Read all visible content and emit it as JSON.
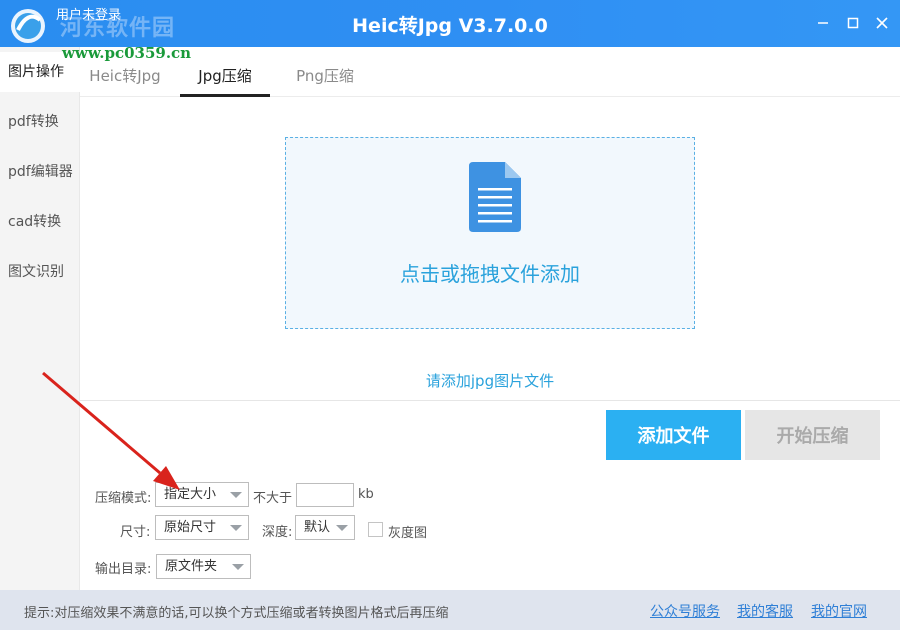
{
  "titlebar": {
    "user_label": "用户未登录",
    "watermark": "河东软件园",
    "watermark_url": "www.pc0359.cn",
    "app_title": "Heic转Jpg V3.7.0.0",
    "controls": [
      "minimize-icon",
      "maximize-icon",
      "close-icon"
    ]
  },
  "sidebar": {
    "items": [
      {
        "label": "图片操作",
        "active": true
      },
      {
        "label": "pdf转换",
        "active": false
      },
      {
        "label": "pdf编辑器",
        "active": false
      },
      {
        "label": "cad转换",
        "active": false
      },
      {
        "label": "图文识别",
        "active": false
      }
    ]
  },
  "tabs": [
    {
      "label": "Heic转Jpg",
      "active": false
    },
    {
      "label": "Jpg压缩",
      "active": true
    },
    {
      "label": "Png压缩",
      "active": false
    }
  ],
  "dropzone": {
    "icon": "document-icon",
    "text": "点击或拖拽文件添加"
  },
  "hint": "请添加jpg图片文件",
  "buttons": {
    "add": "添加文件",
    "start": "开始压缩"
  },
  "settings": {
    "mode_label": "压缩模式:",
    "mode_value": "指定大小",
    "max_label": "不大于",
    "max_value": "",
    "max_unit": "kb",
    "size_label": "尺寸:",
    "size_value": "原始尺寸",
    "depth_label": "深度:",
    "depth_value": "默认",
    "gray_label": "灰度图",
    "gray_checked": false,
    "output_label": "输出目录:",
    "output_value": "原文件夹"
  },
  "footer": {
    "tip": "提示:对压缩效果不满意的话,可以换个方式压缩或者转换图片格式后再压缩",
    "links": [
      "公众号服务",
      "我的客服",
      "我的官网"
    ]
  },
  "colors": {
    "titlebar": "#2f8ff3",
    "accent": "#2aa2dc",
    "primary_button": "#2bb0f2",
    "disabled_button": "#e6e6e6",
    "annotation_arrow": "#d9231c"
  }
}
